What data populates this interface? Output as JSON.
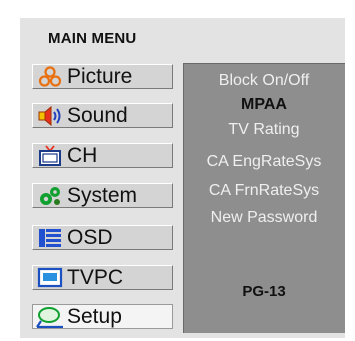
{
  "menu": {
    "title": "MAIN MENU",
    "items": [
      {
        "label": "Picture",
        "icon": "people-icon"
      },
      {
        "label": "Sound",
        "icon": "speaker-icon"
      },
      {
        "label": "CH",
        "icon": "tv-icon"
      },
      {
        "label": "System",
        "icon": "gears-icon"
      },
      {
        "label": "OSD",
        "icon": "menu-bars-icon"
      },
      {
        "label": "TVPC",
        "icon": "monitor-icon"
      },
      {
        "label": "Setup",
        "icon": "setup-icon"
      }
    ],
    "selected": "Setup"
  },
  "submenu": {
    "options": [
      "Block On/Off",
      "MPAA",
      "TV Rating",
      "CA EngRateSys",
      "CA FrnRateSys",
      "New Password"
    ],
    "active": "MPAA",
    "value": "PG-13"
  },
  "colors": {
    "panel_bg": "#e3e3e3",
    "submenu_bg": "#8e8e8e",
    "selected_item_bg": "#f4f4f4",
    "icon_orange": "#e87010",
    "icon_blue": "#2050d0",
    "icon_green": "#10a030"
  }
}
